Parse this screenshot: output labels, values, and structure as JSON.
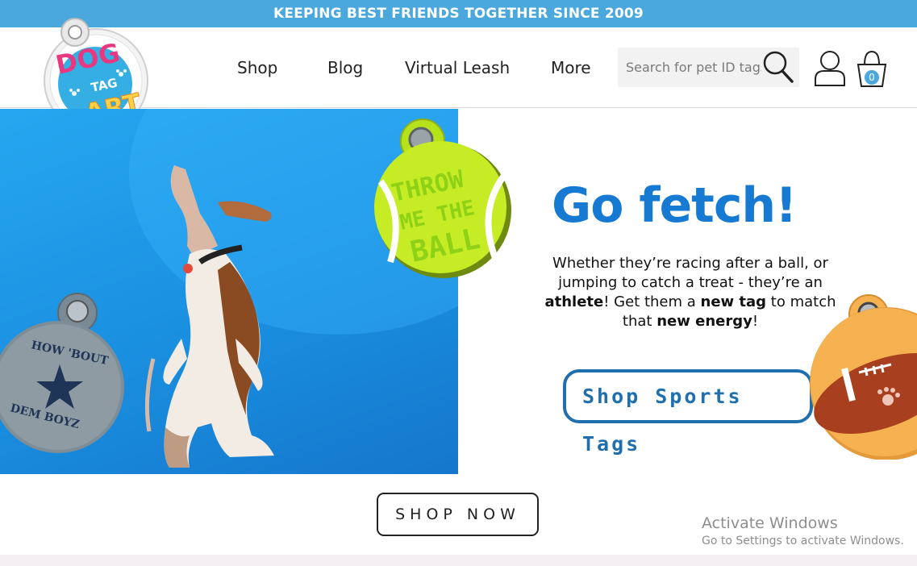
{
  "announcement": "KEEPING BEST FRIENDS TOGETHER SINCE 2009",
  "logo": {
    "line1": "DOG",
    "line2": "TAG",
    "line3": "ART"
  },
  "nav": [
    {
      "label": "Shop"
    },
    {
      "label": "Blog"
    },
    {
      "label": "Virtual Leash"
    },
    {
      "label": "More"
    }
  ],
  "search": {
    "placeholder": "Search for pet ID tags",
    "icon": "magnifier-icon"
  },
  "account": {
    "icon": "account-icon"
  },
  "cart": {
    "icon": "shopping-bag-icon",
    "count": "0"
  },
  "hero": {
    "headline": "Go fetch!",
    "blurb_parts": [
      "Whether they’re racing after a ball, or jumping to catch a treat - they’re an ",
      "athlete",
      "! Get them a ",
      "new tag",
      " to match that ",
      "new energy",
      "!"
    ],
    "cta": "Shop Sports Tags",
    "tag_ball": {
      "line1": "THROW",
      "line2": "ME THE",
      "line3": "BALL"
    },
    "tag_star": {
      "top": "HOW 'BOUT",
      "bottom": "DEM BOYZ"
    }
  },
  "shop_now": "SHOP NOW",
  "watermark": {
    "title": "Activate Windows",
    "subtitle": "Go to Settings to activate Windows."
  },
  "colors": {
    "topbar": "#4aa8dc",
    "headline": "#1679d2",
    "cta_border": "#1f6fae",
    "hero_bg": "#1a8fe0"
  }
}
